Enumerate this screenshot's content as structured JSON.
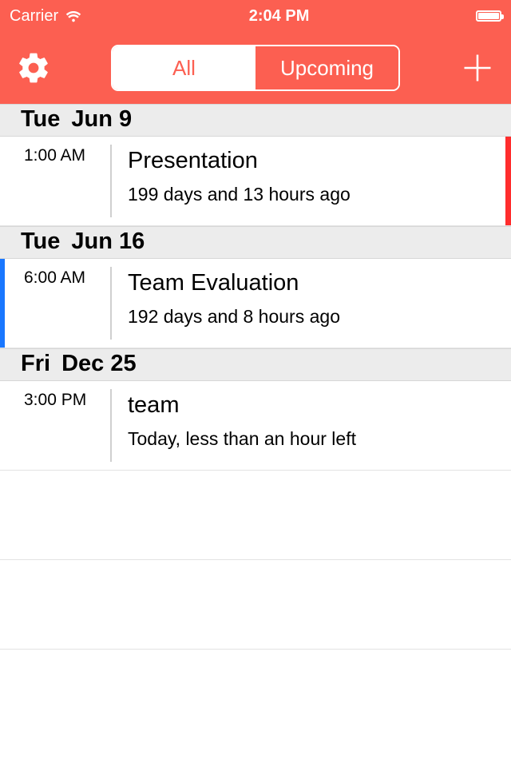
{
  "status": {
    "carrier": "Carrier",
    "time": "2:04 PM"
  },
  "nav": {
    "segments": {
      "all": "All",
      "upcoming": "Upcoming"
    }
  },
  "sections": [
    {
      "weekday": "Tue",
      "date": "Jun 9",
      "events": [
        {
          "time": "1:00 AM",
          "title": "Presentation",
          "subtitle": "199 days and 13 hours ago",
          "stripe": "red"
        }
      ]
    },
    {
      "weekday": "Tue",
      "date": "Jun 16",
      "events": [
        {
          "time": "6:00 AM",
          "title": "Team Evaluation",
          "subtitle": "192 days and 8 hours ago",
          "stripe": "blue"
        }
      ]
    },
    {
      "weekday": "Fri",
      "date": "Dec 25",
      "events": [
        {
          "time": "3:00 PM",
          "title": "team",
          "subtitle": "Today, less than an hour left",
          "stripe": "none"
        }
      ]
    }
  ]
}
